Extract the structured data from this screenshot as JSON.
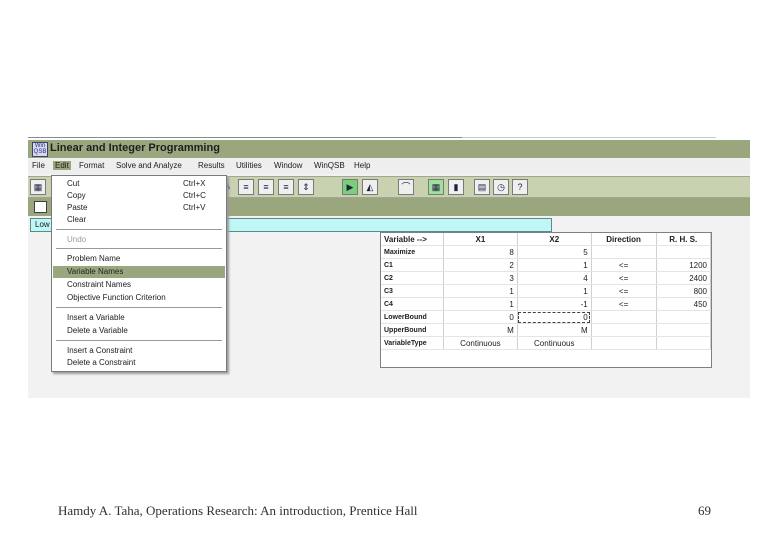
{
  "window": {
    "title": "Linear and Integer Programming",
    "icon_text": "Win QSB"
  },
  "menubar": {
    "items": [
      "File",
      "Edit",
      "Format",
      "Solve and Analyze",
      "Results",
      "Utilities",
      "Window",
      "WinQSB",
      "Help"
    ],
    "active": "Edit"
  },
  "toolbar": {
    "icons": [
      "grid-icon",
      "font-icon",
      "align-left-icon",
      "align-center-icon",
      "align-right-icon",
      "column-width-icon",
      "run-icon",
      "graph-icon",
      "chart-icon",
      "spreadsheet-icon",
      "bar-chart-icon",
      "calculator-icon",
      "clock-icon",
      "help-icon"
    ]
  },
  "cell_editor": {
    "ref": "Low"
  },
  "edit_menu": {
    "items": [
      {
        "label": "Cut",
        "shortcut": "Ctrl+X",
        "disabled": false,
        "selected": false
      },
      {
        "label": "Copy",
        "shortcut": "Ctrl+C",
        "disabled": false,
        "selected": false
      },
      {
        "label": "Paste",
        "shortcut": "Ctrl+V",
        "disabled": false,
        "selected": false
      },
      {
        "label": "Clear",
        "shortcut": "",
        "disabled": false,
        "selected": false
      },
      {
        "label": "Undo",
        "shortcut": "",
        "disabled": true,
        "selected": false
      },
      {
        "label": "Problem Name",
        "shortcut": "",
        "disabled": false,
        "selected": false
      },
      {
        "label": "Variable Names",
        "shortcut": "",
        "disabled": false,
        "selected": true
      },
      {
        "label": "Constraint Names",
        "shortcut": "",
        "disabled": false,
        "selected": false
      },
      {
        "label": "Objective Function Criterion",
        "shortcut": "",
        "disabled": false,
        "selected": false
      },
      {
        "label": "Insert a Variable",
        "shortcut": "",
        "disabled": false,
        "selected": false
      },
      {
        "label": "Delete a Variable",
        "shortcut": "",
        "disabled": false,
        "selected": false
      },
      {
        "label": "Insert a Constraint",
        "shortcut": "",
        "disabled": false,
        "selected": false
      },
      {
        "label": "Delete a Constraint",
        "shortcut": "",
        "disabled": false,
        "selected": false
      }
    ]
  },
  "grid": {
    "headers": [
      "Variable -->",
      "X1",
      "X2",
      "Direction",
      "R. H. S."
    ],
    "rows": [
      [
        "Maximize",
        "8",
        "5",
        "",
        ""
      ],
      [
        "C1",
        "2",
        "1",
        "<=",
        "1200"
      ],
      [
        "C2",
        "3",
        "4",
        "<=",
        "2400"
      ],
      [
        "C3",
        "1",
        "1",
        "<=",
        "800"
      ],
      [
        "C4",
        "1",
        "-1",
        "<=",
        "450"
      ],
      [
        "LowerBound",
        "0",
        "0",
        "",
        ""
      ],
      [
        "UpperBound",
        "M",
        "M",
        "",
        ""
      ],
      [
        "VariableType",
        "Continuous",
        "Continuous",
        "",
        ""
      ]
    ]
  },
  "footer": {
    "citation": "Hamdy A. Taha, Operations Research: An introduction, Prentice Hall",
    "page": "69"
  }
}
